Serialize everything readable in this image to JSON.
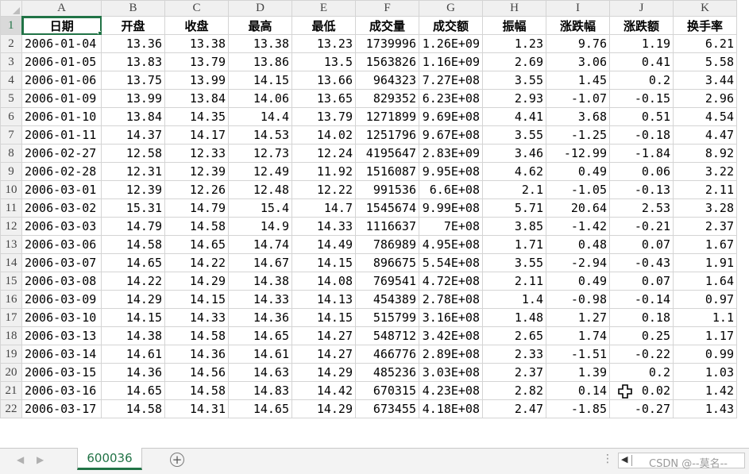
{
  "sheet": {
    "column_letters": [
      "A",
      "B",
      "C",
      "D",
      "E",
      "F",
      "G",
      "H",
      "I",
      "J",
      "K"
    ],
    "header_row": [
      "日期",
      "开盘",
      "收盘",
      "最高",
      "最低",
      "成交量",
      "成交额",
      "振幅",
      "涨跌幅",
      "涨跌额",
      "换手率"
    ],
    "header_row_number": "1",
    "active_cell": "A1",
    "rows": [
      {
        "n": "2",
        "c": [
          "2006-01-04",
          "13.36",
          "13.38",
          "13.38",
          "13.23",
          "1739996",
          "1.26E+09",
          "1.23",
          "9.76",
          "1.19",
          "6.21"
        ]
      },
      {
        "n": "3",
        "c": [
          "2006-01-05",
          "13.83",
          "13.79",
          "13.86",
          "13.5",
          "1563826",
          "1.16E+09",
          "2.69",
          "3.06",
          "0.41",
          "5.58"
        ]
      },
      {
        "n": "4",
        "c": [
          "2006-01-06",
          "13.75",
          "13.99",
          "14.15",
          "13.66",
          "964323",
          "7.27E+08",
          "3.55",
          "1.45",
          "0.2",
          "3.44"
        ]
      },
      {
        "n": "5",
        "c": [
          "2006-01-09",
          "13.99",
          "13.84",
          "14.06",
          "13.65",
          "829352",
          "6.23E+08",
          "2.93",
          "-1.07",
          "-0.15",
          "2.96"
        ]
      },
      {
        "n": "6",
        "c": [
          "2006-01-10",
          "13.84",
          "14.35",
          "14.4",
          "13.79",
          "1271899",
          "9.69E+08",
          "4.41",
          "3.68",
          "0.51",
          "4.54"
        ]
      },
      {
        "n": "7",
        "c": [
          "2006-01-11",
          "14.37",
          "14.17",
          "14.53",
          "14.02",
          "1251796",
          "9.67E+08",
          "3.55",
          "-1.25",
          "-0.18",
          "4.47"
        ]
      },
      {
        "n": "8",
        "c": [
          "2006-02-27",
          "12.58",
          "12.33",
          "12.73",
          "12.24",
          "4195647",
          "2.83E+09",
          "3.46",
          "-12.99",
          "-1.84",
          "8.92"
        ]
      },
      {
        "n": "9",
        "c": [
          "2006-02-28",
          "12.31",
          "12.39",
          "12.49",
          "11.92",
          "1516087",
          "9.95E+08",
          "4.62",
          "0.49",
          "0.06",
          "3.22"
        ]
      },
      {
        "n": "10",
        "c": [
          "2006-03-01",
          "12.39",
          "12.26",
          "12.48",
          "12.22",
          "991536",
          "6.6E+08",
          "2.1",
          "-1.05",
          "-0.13",
          "2.11"
        ]
      },
      {
        "n": "11",
        "c": [
          "2006-03-02",
          "15.31",
          "14.79",
          "15.4",
          "14.7",
          "1545674",
          "9.99E+08",
          "5.71",
          "20.64",
          "2.53",
          "3.28"
        ]
      },
      {
        "n": "12",
        "c": [
          "2006-03-03",
          "14.79",
          "14.58",
          "14.9",
          "14.33",
          "1116637",
          "7E+08",
          "3.85",
          "-1.42",
          "-0.21",
          "2.37"
        ]
      },
      {
        "n": "13",
        "c": [
          "2006-03-06",
          "14.58",
          "14.65",
          "14.74",
          "14.49",
          "786989",
          "4.95E+08",
          "1.71",
          "0.48",
          "0.07",
          "1.67"
        ]
      },
      {
        "n": "14",
        "c": [
          "2006-03-07",
          "14.65",
          "14.22",
          "14.67",
          "14.15",
          "896675",
          "5.54E+08",
          "3.55",
          "-2.94",
          "-0.43",
          "1.91"
        ]
      },
      {
        "n": "15",
        "c": [
          "2006-03-08",
          "14.22",
          "14.29",
          "14.38",
          "14.08",
          "769541",
          "4.72E+08",
          "2.11",
          "0.49",
          "0.07",
          "1.64"
        ]
      },
      {
        "n": "16",
        "c": [
          "2006-03-09",
          "14.29",
          "14.15",
          "14.33",
          "14.13",
          "454389",
          "2.78E+08",
          "1.4",
          "-0.98",
          "-0.14",
          "0.97"
        ]
      },
      {
        "n": "17",
        "c": [
          "2006-03-10",
          "14.15",
          "14.33",
          "14.36",
          "14.15",
          "515799",
          "3.16E+08",
          "1.48",
          "1.27",
          "0.18",
          "1.1"
        ]
      },
      {
        "n": "18",
        "c": [
          "2006-03-13",
          "14.38",
          "14.58",
          "14.65",
          "14.27",
          "548712",
          "3.42E+08",
          "2.65",
          "1.74",
          "0.25",
          "1.17"
        ]
      },
      {
        "n": "19",
        "c": [
          "2006-03-14",
          "14.61",
          "14.36",
          "14.61",
          "14.27",
          "466776",
          "2.89E+08",
          "2.33",
          "-1.51",
          "-0.22",
          "0.99"
        ]
      },
      {
        "n": "20",
        "c": [
          "2006-03-15",
          "14.36",
          "14.56",
          "14.63",
          "14.29",
          "485236",
          "3.03E+08",
          "2.37",
          "1.39",
          "0.2",
          "1.03"
        ]
      },
      {
        "n": "21",
        "c": [
          "2006-03-16",
          "14.65",
          "14.58",
          "14.83",
          "14.42",
          "670315",
          "4.23E+08",
          "2.82",
          "0.14",
          "0.02",
          "1.42"
        ]
      },
      {
        "n": "22",
        "c": [
          "2006-03-17",
          "14.58",
          "14.31",
          "14.65",
          "14.29",
          "673455",
          "4.18E+08",
          "2.47",
          "-1.85",
          "-0.27",
          "1.43"
        ]
      }
    ]
  },
  "tabbar": {
    "nav_prev": "◀",
    "nav_next": "▶",
    "sheet_tab": "600036",
    "add_sheet": "+",
    "dots": "⋮",
    "scroll_left": "◀",
    "watermark": "CSDN @--莫名--"
  },
  "colors": {
    "accent": "#217346",
    "grid": "#d4d4d4",
    "header_bg": "#f0f0f0"
  }
}
